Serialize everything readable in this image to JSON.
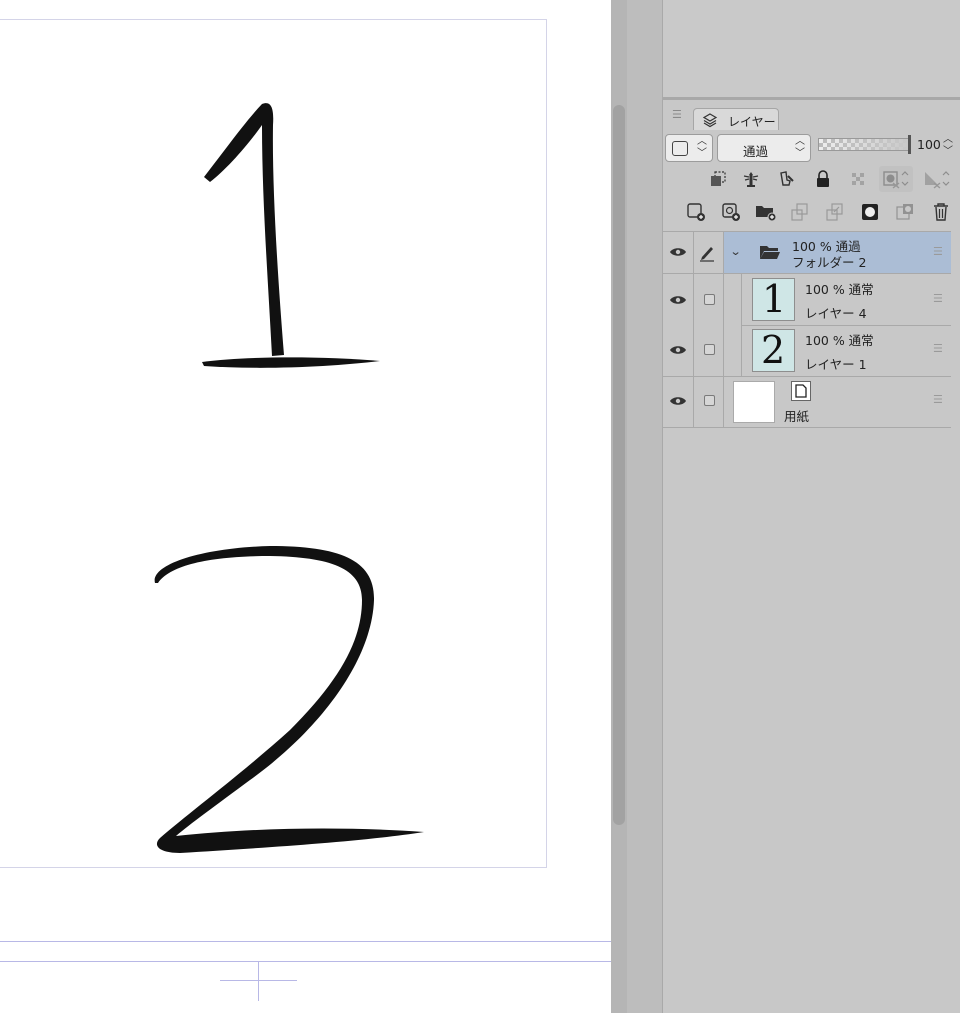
{
  "canvas": {
    "glyph_one": "1",
    "glyph_two": "2"
  },
  "layer_panel": {
    "tab_label": "レイヤー",
    "blend_mode": "通過",
    "opacity_value": "100",
    "layers": [
      {
        "opacity_blend": "100 % 通過",
        "name": "フォルダー 2"
      },
      {
        "opacity_blend": "100 % 通常",
        "name": "レイヤー 4",
        "thumb_text": "1"
      },
      {
        "opacity_blend": "100 % 通常",
        "name": "レイヤー 1",
        "thumb_text": "2"
      },
      {
        "name": "用紙"
      }
    ]
  },
  "colors": {
    "selected_row": "#abbdd5",
    "panel_bg": "#c8c8c8",
    "guide": "#b8b8e6"
  }
}
